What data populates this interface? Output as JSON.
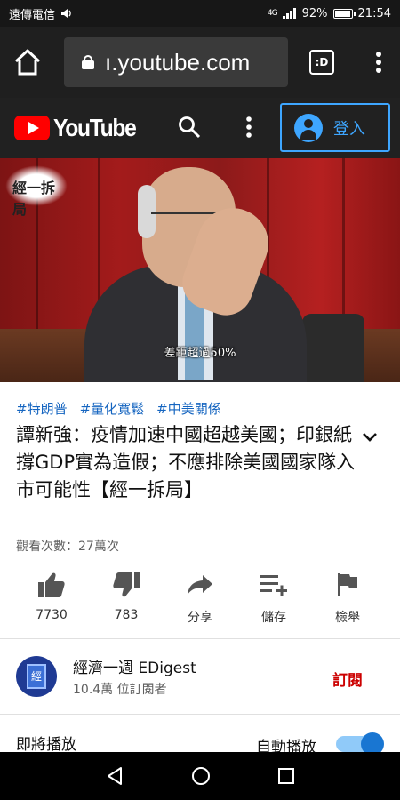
{
  "status_bar": {
    "carrier": "遠傳電信",
    "network": "4G",
    "battery": "92%",
    "battery_level": 0.92,
    "time": "21:54"
  },
  "browser": {
    "url": "ı.youtube.com",
    "tab_label": ":D"
  },
  "youtube_header": {
    "logo_text": "YouTube",
    "signin_label": "登入"
  },
  "video": {
    "stamp_text": "經一拆局",
    "caption": "差距超過50%"
  },
  "info": {
    "hashtags": [
      "#特朗普",
      "#量化寬鬆",
      "#中美關係"
    ],
    "title": "譚新強：疫情加速中國超越美國；印銀紙撐GDP實為造假；不應排除美國國家隊入市可能性【經一拆局】",
    "views": "觀看次數：27萬次"
  },
  "actions": [
    {
      "icon": "thumbs-up-icon",
      "label": "7730"
    },
    {
      "icon": "thumbs-down-icon",
      "label": "783"
    },
    {
      "icon": "share-icon",
      "label": "分享"
    },
    {
      "icon": "save-to-playlist-icon",
      "label": "儲存"
    },
    {
      "icon": "flag-icon",
      "label": "檢舉"
    }
  ],
  "channel": {
    "name": "經濟一週 EDigest",
    "subscribers": "10.4萬 位訂閱者",
    "avatar_text": "經",
    "subscribe_label": "訂閱"
  },
  "up_next": {
    "label": "即將播放",
    "autoplay_label": "自動播放",
    "autoplay_on": true
  },
  "colors": {
    "youtube_red": "#ff0000",
    "link_blue": "#3ea6ff",
    "hashtag_blue": "#1565c0",
    "subscribe_red": "#cc0000"
  }
}
